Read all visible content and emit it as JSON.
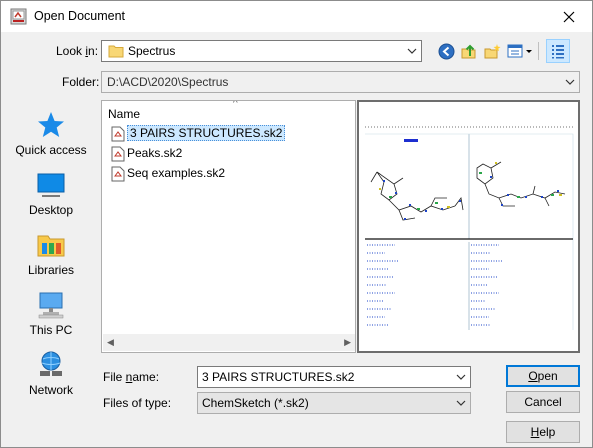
{
  "window": {
    "title": "Open Document"
  },
  "lookin": {
    "label_pre": "Look ",
    "label_key": "i",
    "label_post": "n:",
    "value": "Spectrus"
  },
  "toolbar": {
    "icons": [
      "back-icon",
      "up-folder-icon",
      "new-folder-icon",
      "view-menu-icon",
      "details-view-icon"
    ]
  },
  "folder": {
    "label": "Folder:",
    "value": "D:\\ACD\\2020\\Spectrus"
  },
  "places": [
    {
      "label": "Quick access"
    },
    {
      "label": "Desktop"
    },
    {
      "label": "Libraries"
    },
    {
      "label": "This PC"
    },
    {
      "label": "Network"
    }
  ],
  "filelist": {
    "column": "Name",
    "files": [
      {
        "name": "3 PAIRS STRUCTURES.sk2",
        "selected": true
      },
      {
        "name": "Peaks.sk2",
        "selected": false
      },
      {
        "name": "Seq examples.sk2",
        "selected": false
      }
    ]
  },
  "filename": {
    "label_pre": "File ",
    "label_key": "n",
    "label_post": "ame:",
    "value": "3 PAIRS STRUCTURES.sk2"
  },
  "filetype": {
    "label": "Files of type:",
    "value": "ChemSketch (*.sk2)"
  },
  "buttons": {
    "open": {
      "key": "O",
      "rest": "pen"
    },
    "cancel": "Cancel",
    "help": {
      "key": "H",
      "rest": "elp"
    }
  },
  "colors": {
    "accent": "#0078d7",
    "selection": "#cce8ff"
  }
}
